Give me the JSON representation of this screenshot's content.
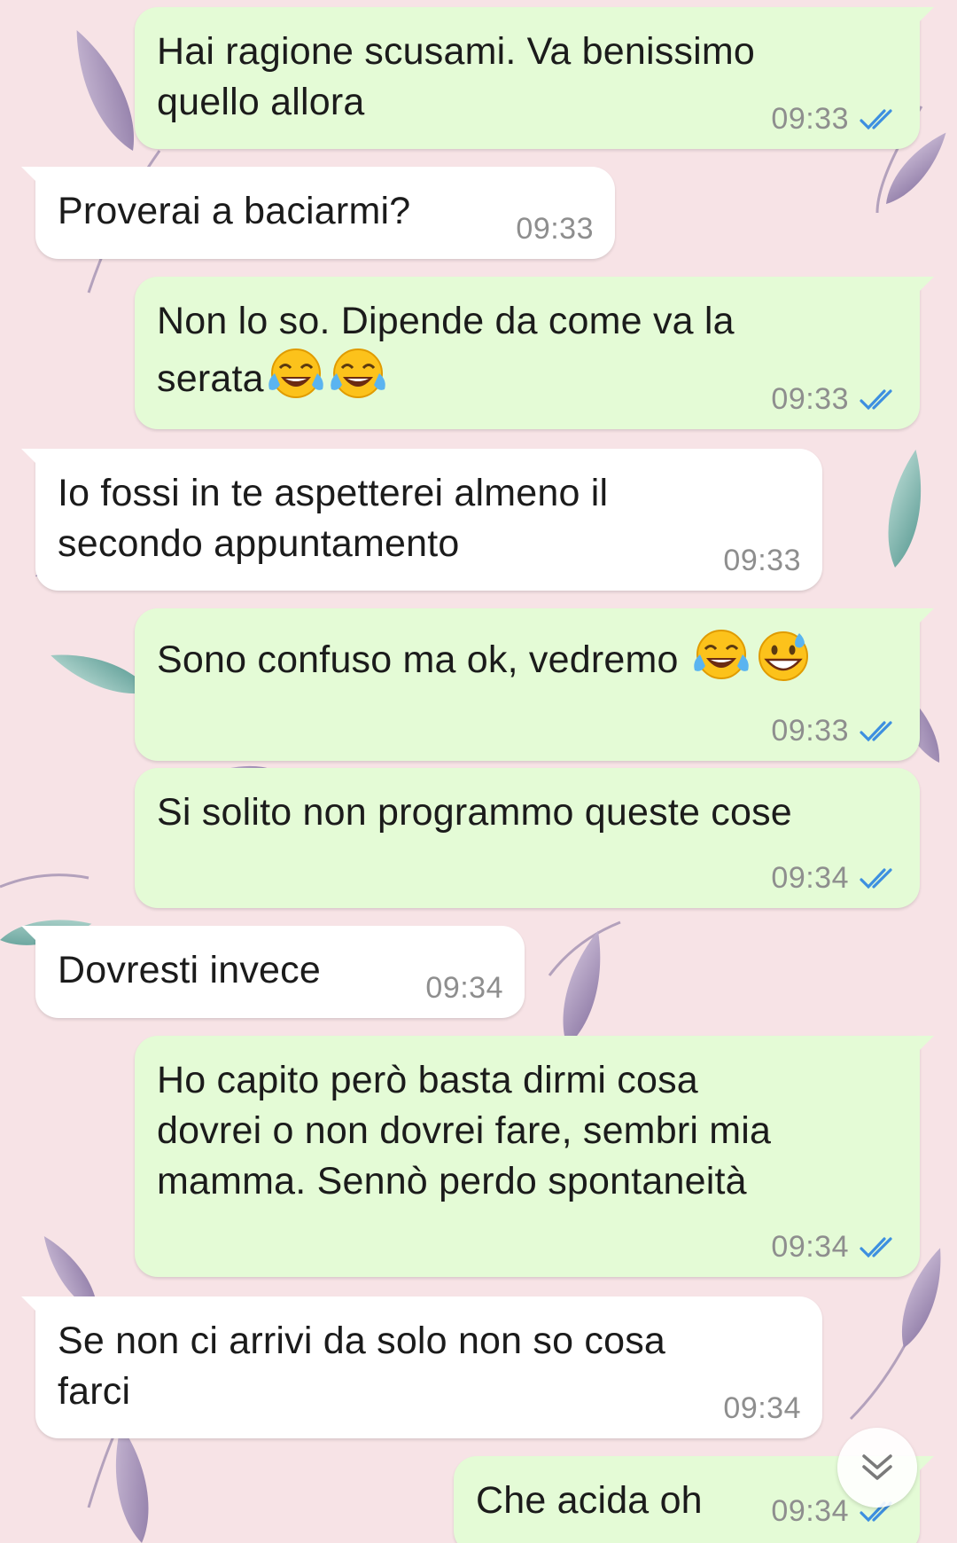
{
  "chat": {
    "messages": [
      {
        "id": "m1",
        "direction": "out",
        "text": "Hai ragione scusami. Va benissimo\nquello allora",
        "time": "09:33",
        "status": "read"
      },
      {
        "id": "m2",
        "direction": "in",
        "text": "Proverai a baciarmi?",
        "time": "09:33"
      },
      {
        "id": "m3",
        "direction": "out",
        "text": "Non lo so. Dipende da come va la\nserata",
        "emojis": [
          "face-with-tears-of-joy",
          "face-with-tears-of-joy"
        ],
        "time": "09:33",
        "status": "read"
      },
      {
        "id": "m4",
        "direction": "in",
        "text": "Io fossi in te aspetterei almeno il\nsecondo appuntamento",
        "time": "09:33"
      },
      {
        "id": "m5",
        "direction": "out",
        "text": "Sono confuso ma ok, vedremo",
        "emojis": [
          "face-with-tears-of-joy",
          "grinning-face-with-sweat"
        ],
        "time": "09:33",
        "status": "read"
      },
      {
        "id": "m6",
        "direction": "out",
        "text": "Si solito non programmo queste cose",
        "time": "09:34",
        "status": "read"
      },
      {
        "id": "m7",
        "direction": "in",
        "text": "Dovresti invece",
        "time": "09:34"
      },
      {
        "id": "m8",
        "direction": "out",
        "text": "Ho capito però basta dirmi cosa\ndovrei o non dovrei fare, sembri mia\nmamma. Sennò perdo spontaneità",
        "time": "09:34",
        "status": "read"
      },
      {
        "id": "m9",
        "direction": "in",
        "text": "Se non ci arrivi da solo non so cosa\nfarci",
        "time": "09:34"
      },
      {
        "id": "m10",
        "direction": "out",
        "text": "Che acida oh",
        "time": "09:34",
        "status": "read"
      }
    ],
    "scroll_button_icon": "double-chevron-down-icon"
  },
  "colors": {
    "outgoing_bubble": "#e4fbd6",
    "incoming_bubble": "#ffffff",
    "wallpaper": "#f7e3e6",
    "read_ticks": "#3d8fe0",
    "timestamp": "#8e8e8e"
  }
}
